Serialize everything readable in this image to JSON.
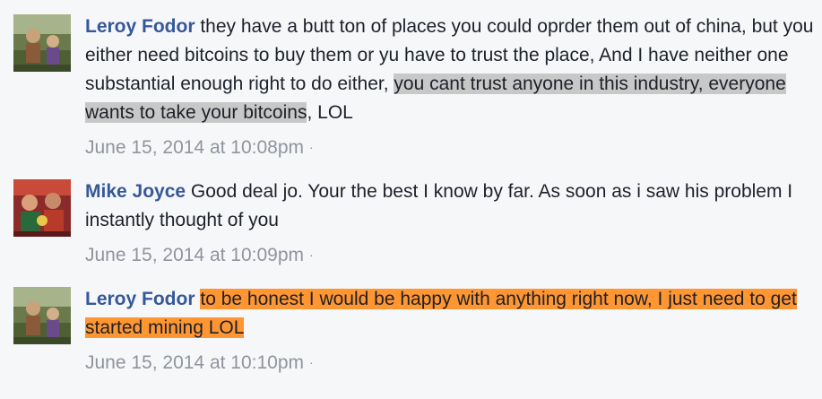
{
  "comments": [
    {
      "author": "Leroy Fodor",
      "text_plain": " they have a butt ton of places you could oprder them out of china, but you either need bitcoins to buy them or yu have to trust the place, And I have neither one substantial enough right to do either, ",
      "text_highlight": "you cant trust anyone in this industry, everyone wants to take your bitcoins",
      "text_after": ", LOL",
      "timestamp": "June 15, 2014 at 10:08pm",
      "separator": "·",
      "avatar_icon": "profile-photo-icon"
    },
    {
      "author": "Mike Joyce",
      "text_plain": " Good deal jo. Your the best I know by far. As soon as i saw his problem I instantly thought of you",
      "timestamp": "June 15, 2014 at 10:09pm",
      "separator": "·",
      "avatar_icon": "profile-photo-icon"
    },
    {
      "author": "Leroy Fodor",
      "text_highlight": "to be honest I would be happy with anything right now, I just need to get started mining LOL",
      "timestamp": "June 15, 2014 at 10:10pm",
      "separator": "·",
      "avatar_icon": "profile-photo-icon"
    }
  ],
  "colors": {
    "author": "#365899",
    "text": "#1d2129",
    "meta": "#90949c",
    "grey_highlight": "#c8c8c8",
    "orange_highlight": "#ff9632",
    "background": "#f6f7f9"
  }
}
